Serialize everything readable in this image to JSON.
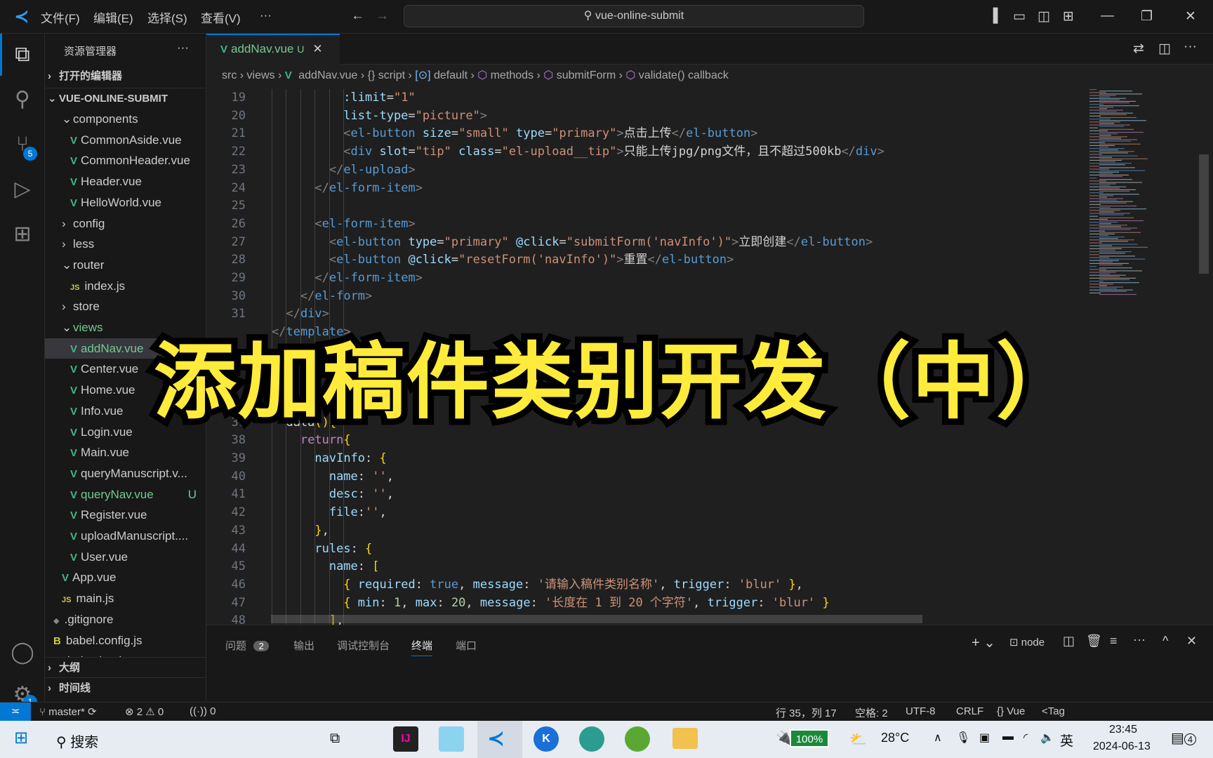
{
  "titlebar": {
    "menus": [
      "文件(F)",
      "编辑(E)",
      "选择(S)",
      "查看(V)",
      "···"
    ],
    "search": "vue-online-submit"
  },
  "activity": {
    "scm_badge": "5",
    "settings_badge": "1"
  },
  "sidebar": {
    "title": "资源管理器",
    "more": "···",
    "open_editors": "打开的编辑器",
    "root": "VUE-ONLINE-SUBMIT",
    "items": [
      {
        "label": "components",
        "kind": "folder-open",
        "depth": 1
      },
      {
        "label": "CommonAside.vue",
        "kind": "vue",
        "depth": 2
      },
      {
        "label": "CommonHeader.vue",
        "kind": "vue",
        "depth": 2
      },
      {
        "label": "Header.vue",
        "kind": "vue",
        "depth": 2
      },
      {
        "label": "HelloWorld.vue",
        "kind": "vue",
        "depth": 2
      },
      {
        "label": "config",
        "kind": "folder",
        "depth": 1
      },
      {
        "label": "less",
        "kind": "folder",
        "depth": 1
      },
      {
        "label": "router",
        "kind": "folder-open",
        "depth": 1
      },
      {
        "label": "index.js",
        "kind": "js",
        "depth": 2
      },
      {
        "label": "store",
        "kind": "folder",
        "depth": 1
      },
      {
        "label": "views",
        "kind": "folder-open",
        "depth": 1,
        "status": "untracked"
      },
      {
        "label": "addNav.vue",
        "kind": "vue",
        "depth": 2,
        "status": "untracked",
        "selected": true
      },
      {
        "label": "Center.vue",
        "kind": "vue",
        "depth": 2
      },
      {
        "label": "Home.vue",
        "kind": "vue",
        "depth": 2
      },
      {
        "label": "Info.vue",
        "kind": "vue",
        "depth": 2
      },
      {
        "label": "Login.vue",
        "kind": "vue",
        "depth": 2
      },
      {
        "label": "Main.vue",
        "kind": "vue",
        "depth": 2
      },
      {
        "label": "queryManuscript.v...",
        "kind": "vue",
        "depth": 2
      },
      {
        "label": "queryNav.vue",
        "kind": "vue",
        "depth": 2,
        "status": "untracked",
        "badge": "U"
      },
      {
        "label": "Register.vue",
        "kind": "vue",
        "depth": 2
      },
      {
        "label": "uploadManuscript....",
        "kind": "vue",
        "depth": 2
      },
      {
        "label": "User.vue",
        "kind": "vue",
        "depth": 2
      },
      {
        "label": "App.vue",
        "kind": "vue",
        "depth": 1
      },
      {
        "label": "main.js",
        "kind": "js",
        "depth": 1
      },
      {
        "label": ".gitignore",
        "kind": "git",
        "depth": 0
      },
      {
        "label": "babel.config.js",
        "kind": "babel",
        "depth": 0
      },
      {
        "label": "index.html",
        "kind": "html",
        "depth": 0
      }
    ],
    "outline": "大纲",
    "timeline": "时间线"
  },
  "editor": {
    "tab": {
      "label": "addNav.vue",
      "badge": "U"
    },
    "breadcrumbs": [
      "src",
      "views",
      "addNav.vue",
      "{} script",
      "default",
      "methods",
      "submitForm",
      "validate() callback"
    ],
    "lines": [
      {
        "n": 19,
        "i": 10,
        "t": ":limit=\"1\""
      },
      {
        "n": 20,
        "i": 10,
        "t": "list-type=\"picture\">"
      },
      {
        "n": 21,
        "i": 10,
        "t": "<el-button size=\"small\" type=\"primary\">点击上传</el-button>"
      },
      {
        "n": 22,
        "i": 10,
        "t": "<div slot=\"tip\" class=\"el-upload__tip\">只能上传jpg/png文件，且不超过500kb</div>"
      },
      {
        "n": 23,
        "i": 8,
        "t": "</el-upload>"
      },
      {
        "n": 24,
        "i": 6,
        "t": "</el-form-item>"
      },
      {
        "n": 25,
        "i": 0,
        "t": ""
      },
      {
        "n": 26,
        "i": 6,
        "t": "<el-form-item>"
      },
      {
        "n": 27,
        "i": 8,
        "t": "<el-button type=\"primary\" @click=\"submitForm('navInfo')\">立即创建</el-button>"
      },
      {
        "n": 28,
        "i": 8,
        "t": "<el-button @click=\"resetForm('navInfo')\">重置</el-button>"
      },
      {
        "n": 29,
        "i": 6,
        "t": "</el-form-item>"
      },
      {
        "n": 30,
        "i": 4,
        "t": "</el-form>"
      },
      {
        "n": 31,
        "i": 2,
        "t": "</div>"
      },
      {
        "n": "",
        "i": 0,
        "t": "</template>"
      },
      {
        "n": "",
        "i": 0,
        "t": ""
      },
      {
        "n": "",
        "i": 0,
        "t": ""
      },
      {
        "n": "",
        "i": 19,
        "t": "m '../ap"
      },
      {
        "n": 36,
        "i": 0,
        "t": "export default {"
      },
      {
        "n": 37,
        "i": 2,
        "t": "data(){"
      },
      {
        "n": 38,
        "i": 4,
        "t": "return{"
      },
      {
        "n": 39,
        "i": 6,
        "t": "navInfo: {"
      },
      {
        "n": 40,
        "i": 8,
        "t": "name: '',"
      },
      {
        "n": 41,
        "i": 8,
        "t": "desc: '',"
      },
      {
        "n": 42,
        "i": 8,
        "t": "file:'',"
      },
      {
        "n": 43,
        "i": 6,
        "t": "},"
      },
      {
        "n": 44,
        "i": 6,
        "t": "rules: {"
      },
      {
        "n": 45,
        "i": 8,
        "t": "name: ["
      },
      {
        "n": 46,
        "i": 10,
        "t": "{ required: true, message: '请输入稿件类别名称', trigger: 'blur' },"
      },
      {
        "n": 47,
        "i": 10,
        "t": "{ min: 1, max: 20, message: '长度在 1 到 20 个字符', trigger: 'blur' }"
      },
      {
        "n": 48,
        "i": 8,
        "t": "],"
      }
    ]
  },
  "overlay_title": "添加稿件类别开发（中）",
  "panel": {
    "tabs": [
      "问题",
      "输出",
      "调试控制台",
      "终端",
      "端口"
    ],
    "problems_count": "2",
    "active": "终端",
    "terminal": "node"
  },
  "statusbar": {
    "branch": "master*",
    "errors": "2",
    "warnings": "0",
    "ports": "0",
    "position": "行 35，列 17",
    "spaces": "空格: 2",
    "encoding": "UTF-8",
    "eol": "CRLF",
    "language": "Vue",
    "extra": "<Tag"
  },
  "taskbar": {
    "search": "搜索",
    "battery": "100%",
    "temp": "28°C",
    "ime": "英",
    "time": "23:45",
    "date": "2024-06-13",
    "notifications": "4"
  },
  "colors": {
    "accent": "#0078d4",
    "untracked": "#73c991",
    "overlay_text": "#ffeb3b"
  }
}
